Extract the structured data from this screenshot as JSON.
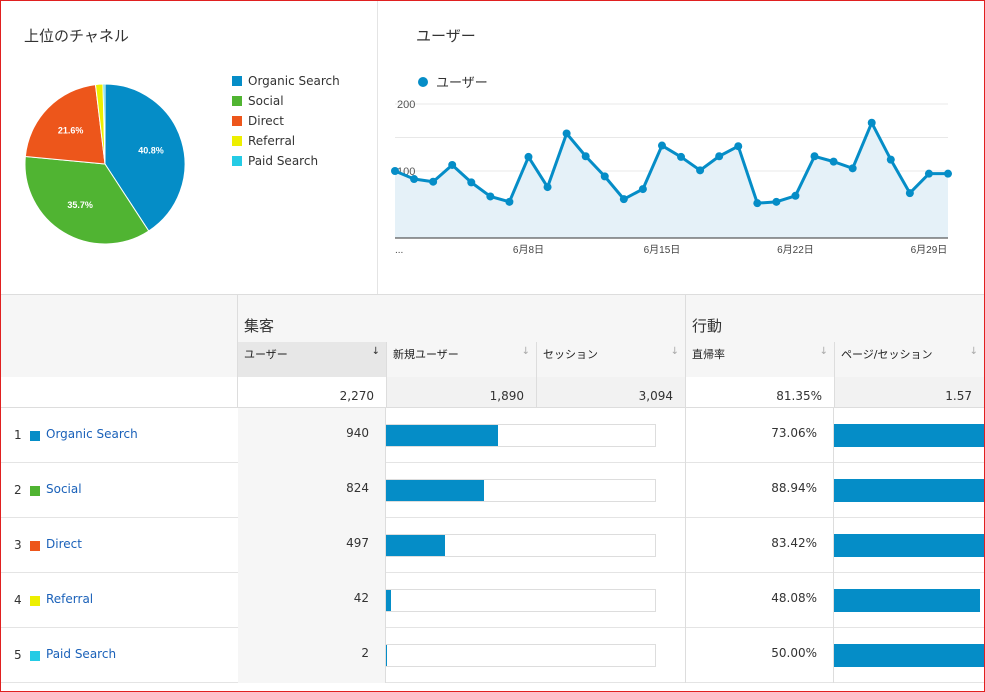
{
  "pie_panel": {
    "title": "上位のチャネル"
  },
  "line_panel": {
    "title": "ユーザー"
  },
  "colors": {
    "accent": "#058dc7",
    "link": "#1a61b9",
    "frame": "#e02020"
  },
  "chart_data": [
    {
      "type": "pie",
      "title": "上位のチャネル",
      "slices": [
        {
          "label": "Organic Search",
          "value": 40.8,
          "color": "#058dc7",
          "data_label": "40.8%"
        },
        {
          "label": "Social",
          "value": 35.7,
          "color": "#50b432",
          "data_label": "35.7%"
        },
        {
          "label": "Direct",
          "value": 21.6,
          "color": "#ed561b",
          "data_label": "21.6%"
        },
        {
          "label": "Referral",
          "value": 1.5,
          "color": "#edef00",
          "data_label": ""
        },
        {
          "label": "Paid Search",
          "value": 0.4,
          "color": "#24cbe5",
          "data_label": ""
        }
      ],
      "legend_position": "right"
    },
    {
      "type": "area",
      "title": "ユーザー",
      "series": [
        {
          "name": "ユーザー",
          "color": "#058dc7",
          "values": [
            100,
            88,
            84,
            109,
            83,
            62,
            54,
            121,
            76,
            156,
            122,
            92,
            58,
            73,
            138,
            121,
            101,
            122,
            137,
            52,
            54,
            63,
            122,
            114,
            104,
            172,
            117,
            67,
            96,
            96
          ]
        }
      ],
      "x_tick_labels": [
        "...",
        "6月8日",
        "6月15日",
        "6月22日",
        "6月29日"
      ],
      "x_tick_index": [
        0,
        7,
        14,
        21,
        28
      ],
      "ylim": [
        0,
        200
      ],
      "y_ticks": [
        100,
        200
      ],
      "grid": true
    }
  ],
  "table": {
    "groups": {
      "acquisition": "集客",
      "behavior": "行動"
    },
    "columns": {
      "users": "ユーザー",
      "new_users": "新規ユーザー",
      "sessions": "セッション",
      "bounce_rate": "直帰率",
      "pages_per_session": "ページ/セッション"
    },
    "sort_arrow": "↓",
    "sort_arrow_idle": "↓",
    "totals": {
      "users": "2,270",
      "new_users": "1,890",
      "sessions": "3,094",
      "bounce_rate": "81.35%",
      "pages_per_session": "1.57"
    },
    "rows": [
      {
        "rank": "1",
        "channel": "Organic Search",
        "color": "#058dc7",
        "users": "940",
        "new_users_share": 0.415,
        "bounce_rate": "73.06%",
        "pps_share": 1.0
      },
      {
        "rank": "2",
        "channel": "Social",
        "color": "#50b432",
        "users": "824",
        "new_users_share": 0.363,
        "bounce_rate": "88.94%",
        "pps_share": 1.0
      },
      {
        "rank": "3",
        "channel": "Direct",
        "color": "#ed561b",
        "users": "497",
        "new_users_share": 0.219,
        "bounce_rate": "83.42%",
        "pps_share": 1.0
      },
      {
        "rank": "4",
        "channel": "Referral",
        "color": "#edef00",
        "users": "42",
        "new_users_share": 0.019,
        "bounce_rate": "48.08%",
        "pps_share": 0.97
      },
      {
        "rank": "5",
        "channel": "Paid Search",
        "color": "#24cbe5",
        "users": "2",
        "new_users_share": 0.001,
        "bounce_rate": "50.00%",
        "pps_share": 1.0
      }
    ]
  }
}
